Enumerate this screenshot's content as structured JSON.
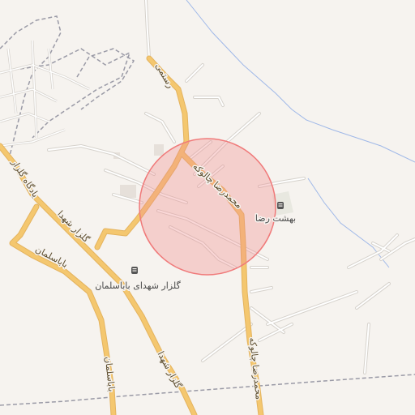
{
  "map": {
    "road_labels": {
      "rostami": "رستمی",
      "chaloke_north": "محمدرضا چالوکه",
      "chaloke_south": "محمدرضا چالوکه",
      "golzar_upper": "گلزار شهدا",
      "golzar_lower": "گلزار شهدا",
      "babasalman_upper": "باباسلمان",
      "babasalman_lower": "باباسلمان",
      "shohada_west": "یادگاه گلزار"
    },
    "poi": {
      "behesht_reza": {
        "label": "بهشت رضا",
        "icon": "cemetery-icon"
      },
      "golzar_babasalman": {
        "label": "گلزار شهدای باباسلمان",
        "icon": "cemetery-icon"
      }
    },
    "highlight": {
      "color": "#f28c8c",
      "shape": "circle"
    },
    "colors": {
      "background": "#f6f3ef",
      "major_road": "#f4c76f",
      "major_road_casing": "#e4b35e",
      "minor_road": "#ffffff",
      "minor_road_casing": "#d6d2cc",
      "boundary": "#9a9aa6",
      "water": "#9fb8e8"
    }
  }
}
